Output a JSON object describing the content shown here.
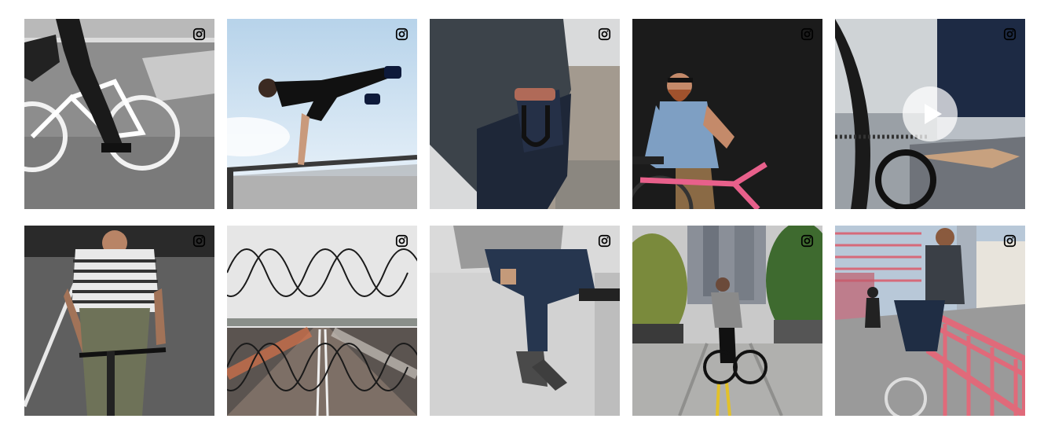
{
  "feed": {
    "tiles": [
      {
        "subject": "rider-white-fixie-street",
        "icon": "instagram-icon"
      },
      {
        "subject": "man-vaulting-railing",
        "icon": "instagram-icon"
      },
      {
        "subject": "u-lock-in-back-pocket",
        "icon": "instagram-icon"
      },
      {
        "subject": "bearded-man-pink-bike",
        "icon": "instagram-icon"
      },
      {
        "subject": "rolled-cuff-bike-chain-video",
        "icon": "instagram-icon",
        "overlay_icon": "play-icon"
      },
      {
        "subject": "man-riding-striped-shirt",
        "icon": "instagram-icon"
      },
      {
        "subject": "fence-over-highway",
        "icon": "instagram-icon"
      },
      {
        "subject": "man-sitting-on-wall",
        "icon": "instagram-icon"
      },
      {
        "subject": "rider-city-street",
        "icon": "instagram-icon"
      },
      {
        "subject": "man-red-bridge-railing",
        "icon": "instagram-icon"
      }
    ]
  },
  "colors": {
    "background": "#ffffff",
    "icon": "#000000",
    "play_overlay": "#ffffff"
  }
}
